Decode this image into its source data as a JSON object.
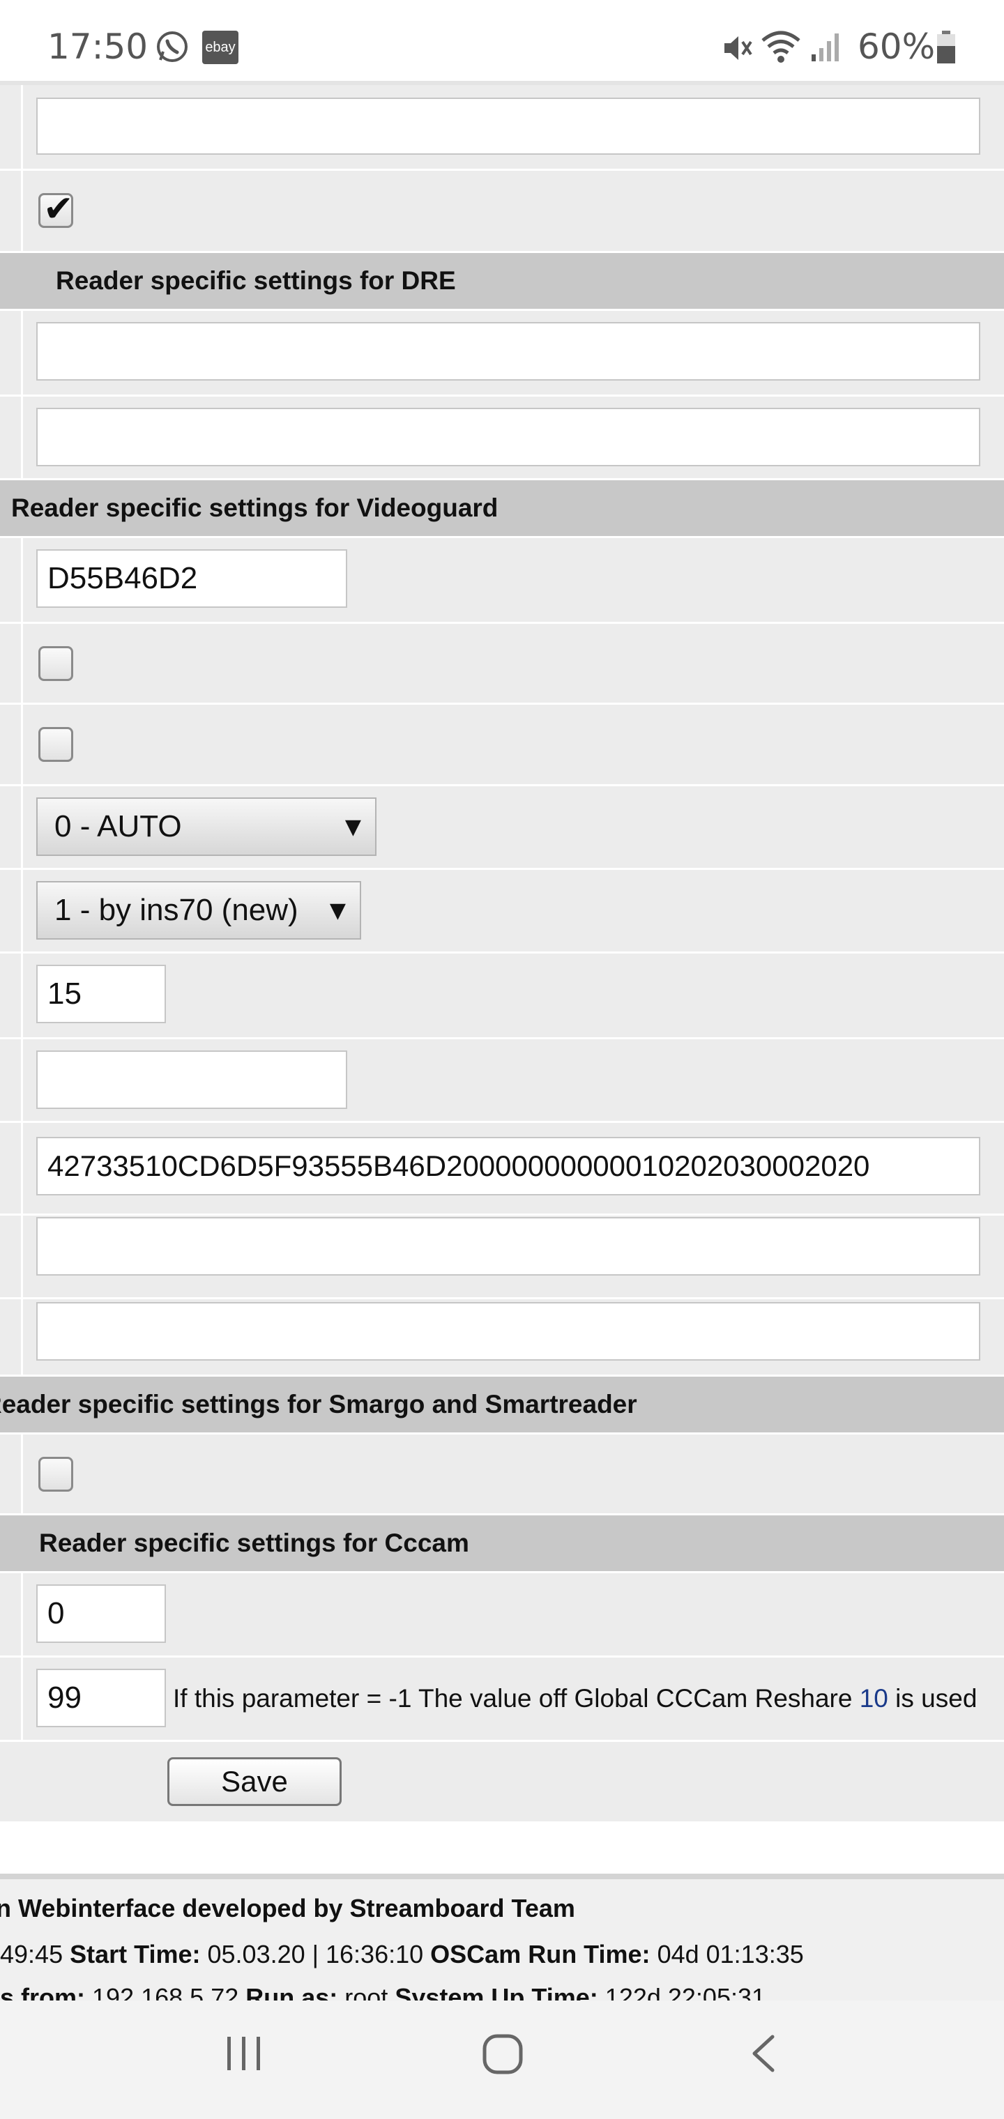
{
  "status_bar": {
    "time": "17:50",
    "app_icons": [
      "whatsapp-icon",
      "ebay-icon"
    ],
    "ebay_label": "ebay",
    "battery": "60%",
    "indicators": [
      "mute-icon",
      "wifi-icon",
      "signal-icon",
      "battery-icon"
    ]
  },
  "sections": {
    "dre": "Reader specific settings for DRE",
    "videoguard": "Reader specific settings for Videoguard",
    "smargo": "Reader specific settings for Smargo and Smartreader",
    "cccam": "Reader specific settings for Cccam"
  },
  "fields": {
    "top_text": "",
    "dre_field_1": "",
    "dre_field_2": "",
    "vg_boxkey": "D55B46D2",
    "vg_select_1": "0 - AUTO",
    "vg_select_2": "1 - by ins70 (new)",
    "vg_number": "15",
    "vg_short_field": "",
    "vg_long_key": "42733510CD6D5F93555B46D20000000000010202030002020",
    "vg_field_a": "",
    "vg_field_b": "",
    "cccam_field_1": "0",
    "cccam_reshare": "99"
  },
  "checkboxes": {
    "top_checkbox": true,
    "vg_checkbox_1": false,
    "vg_checkbox_2": false,
    "smargo_checkbox": false
  },
  "reshare_note_parts": {
    "before": "If this parameter = -1 The value off Global CCCam Reshare ",
    "value": "10",
    "after": " is used"
  },
  "buttons": {
    "save": "Save"
  },
  "footer": {
    "line1": "n Webinterface developed by Streamboard Team",
    "line2": {
      "time_fragment": "49:45",
      "start_label": "Start Time:",
      "start_value": "05.03.20 | 16:36:10",
      "runtime_label": "OSCam Run Time:",
      "runtime_value": "04d 01:13:35"
    },
    "line3": {
      "from_label": "s from:",
      "from_value": "192.168.5.72",
      "runas_label": "Run as:",
      "runas_value": "root",
      "uptime_label": "System Up Time:",
      "uptime_value": "122d 22:05:31"
    }
  },
  "colors": {
    "row_bg": "#ececec",
    "section_bg": "#c8c8c8",
    "link_blue": "#1a3a8a"
  }
}
